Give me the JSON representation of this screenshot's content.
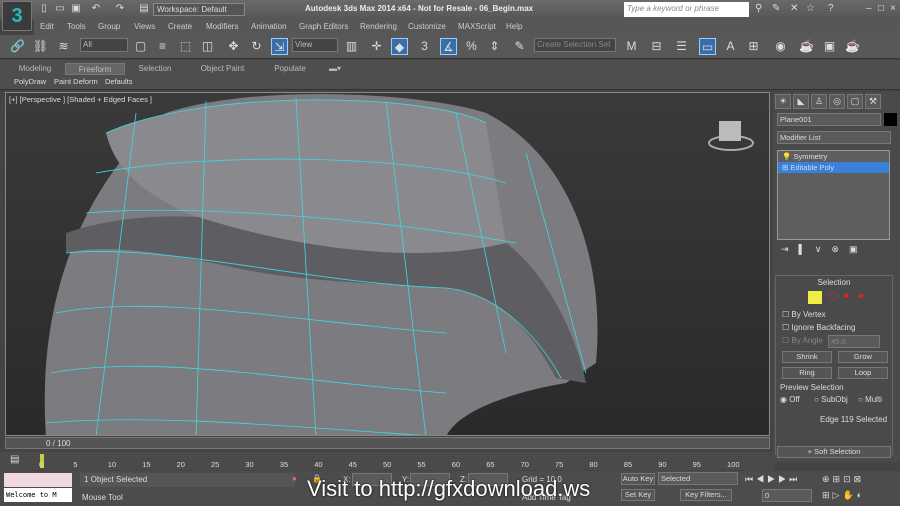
{
  "titlebar": {
    "workspace": "Workspace: Default",
    "title": "Autodesk 3ds Max 2014 x64 - Not for Resale - 06_Begin.max",
    "search_placeholder": "Type a keyword or phrase"
  },
  "menu": [
    "Edit",
    "Tools",
    "Group",
    "Views",
    "Create",
    "Modifiers",
    "Animation",
    "Graph Editors",
    "Rendering",
    "Customize",
    "MAXScript",
    "Help"
  ],
  "toolbar": {
    "selection_filter": "All",
    "ref_coord": "View",
    "named_selection": "Create Selection Set"
  },
  "ribbon": {
    "tabs": [
      "Modeling",
      "Freeform",
      "Selection",
      "Object Paint",
      "Populate"
    ],
    "active_tab": "Freeform",
    "subtabs": [
      "PolyDraw",
      "Paint Deform",
      "Defaults"
    ]
  },
  "viewport": {
    "label": "[+] [Perspective ] [Shaded + Edged Faces ]",
    "wire_color": "#3fd8e0"
  },
  "command_panel": {
    "object_name": "Plane001",
    "modifier_list": "Modifier List",
    "stack": [
      "Symmetry",
      "Editable Poly"
    ],
    "selected_stack": "Editable Poly",
    "selection": {
      "title": "Selection",
      "by_vertex": "By Vertex",
      "ignore_backfacing": "Ignore Backfacing",
      "by_angle": "By Angle",
      "angle_value": "45.0",
      "shrink": "Shrink",
      "grow": "Grow",
      "ring": "Ring",
      "loop": "Loop",
      "preview_title": "Preview Selection",
      "preview_options": [
        "Off",
        "SubObj",
        "Multi"
      ],
      "preview_selected": "Off",
      "status": "Edge 119 Selected"
    },
    "soft_selection": "Soft Selection"
  },
  "timeline": {
    "frame": "0 / 100",
    "ticks": [
      "0",
      "5",
      "10",
      "15",
      "20",
      "25",
      "30",
      "35",
      "40",
      "45",
      "50",
      "55",
      "60",
      "65",
      "70",
      "75",
      "80",
      "85",
      "90",
      "95",
      "100"
    ]
  },
  "status": {
    "welcome": "Welcome to M",
    "selected": "1 Object Selected",
    "prompt": "Mouse Tool",
    "x_label": "X:",
    "y_label": "Y:",
    "z_label": "Z:",
    "grid": "Grid = 10.0",
    "add_time_tag": "Add Time Tag",
    "auto_key": "Auto Key",
    "set_key": "Set Key",
    "key_mode": "Selected",
    "key_filters": "Key Filters...",
    "current_frame": "0"
  },
  "watermark": "Visit to http://gfxdownload.ws"
}
